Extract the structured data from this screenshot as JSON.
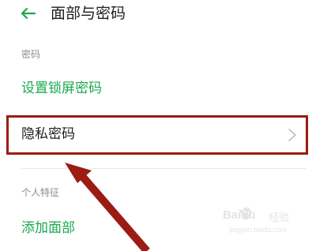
{
  "header": {
    "title": "面部与密码",
    "back_icon": "arrow-left-icon"
  },
  "sections": {
    "password_label": "密码",
    "set_lock_password": "设置锁屏密码",
    "private_password": "隐私密码",
    "personal_features_label": "个人特征",
    "add_face": "添加面部"
  },
  "icons": {
    "chevron": "chevron-right-icon"
  },
  "watermark": {
    "brand": "Baidu",
    "sub": "经验",
    "url": "jingyan.baidu.com"
  },
  "colors": {
    "accent": "#1aa84f",
    "annotation": "#9b1c12",
    "label": "#8c8c8c"
  }
}
